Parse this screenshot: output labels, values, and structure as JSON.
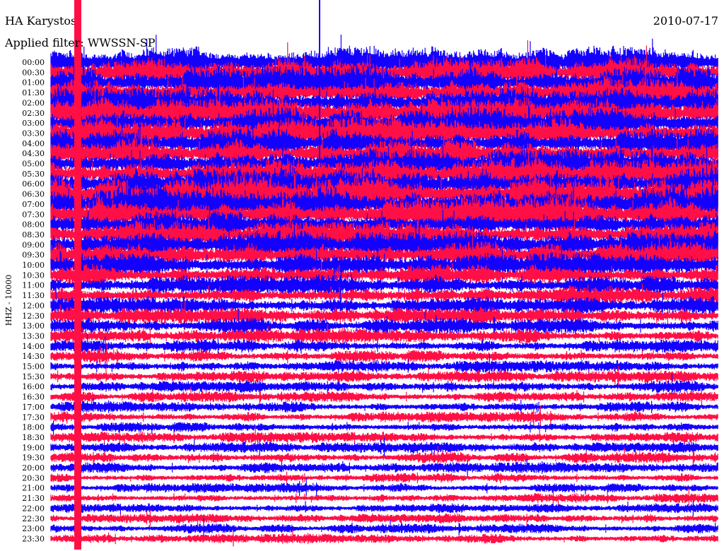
{
  "header": {
    "station": "HA Karystos",
    "date": "2010-07-17",
    "filter": "Applied filter: WWSSN-SP"
  },
  "colors": {
    "blue": "#1400ff",
    "red": "#ff0f46"
  },
  "chart_data": {
    "type": "line",
    "ylabel": "HHZ - 10000",
    "row_labels": [
      "00:00",
      "00:30",
      "01:00",
      "01:30",
      "02:00",
      "02:30",
      "03:00",
      "03:30",
      "04:00",
      "04:30",
      "05:00",
      "05:30",
      "06:00",
      "06:30",
      "07:00",
      "07:30",
      "08:00",
      "08:30",
      "09:00",
      "09:30",
      "10:00",
      "10:30",
      "11:00",
      "11:30",
      "12:00",
      "12:30",
      "13:00",
      "13:30",
      "14:00",
      "14:30",
      "15:00",
      "15:30",
      "16:00",
      "16:30",
      "17:00",
      "17:30",
      "18:00",
      "18:30",
      "19:00",
      "19:30",
      "20:00",
      "20:30",
      "21:00",
      "21:30",
      "22:00",
      "22:30",
      "23:00",
      "23:30"
    ],
    "row_colors": [
      "blue",
      "red"
    ],
    "relative_amplitude": [
      2.6,
      2.7,
      2.8,
      2.7,
      2.7,
      2.6,
      2.6,
      2.6,
      2.5,
      2.5,
      2.5,
      2.6,
      2.8,
      3.0,
      3.0,
      2.9,
      2.4,
      2.3,
      2.3,
      2.2,
      2.0,
      1.8,
      1.7,
      1.6,
      1.5,
      1.4,
      1.3,
      1.2,
      1.1,
      1.1,
      1.0,
      1.0,
      1.0,
      0.9,
      0.9,
      0.9,
      0.9,
      0.9,
      0.9,
      0.9,
      0.9,
      0.8,
      0.8,
      0.8,
      0.8,
      0.8,
      0.8,
      0.8
    ]
  }
}
